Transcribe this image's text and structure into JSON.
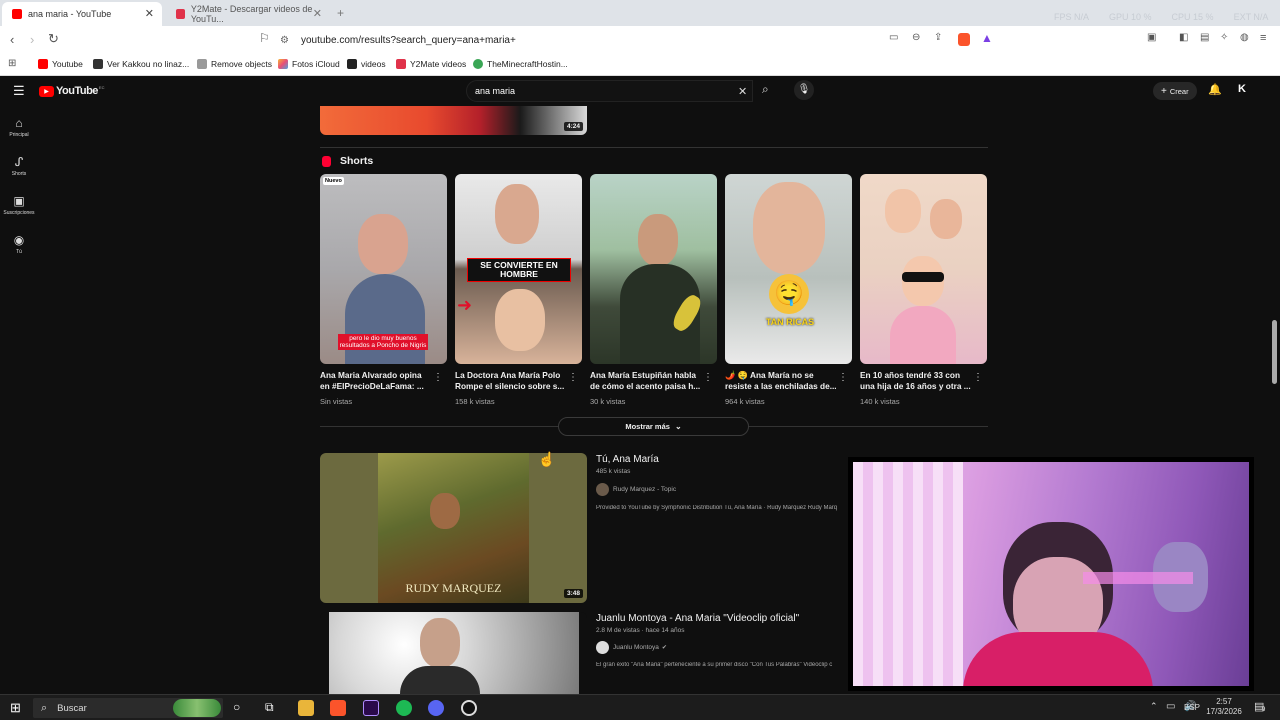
{
  "browser": {
    "tabs": [
      {
        "label": "ana maria - YouTube",
        "active": true
      },
      {
        "label": "Y2Mate - Descargar videos de YouTu...",
        "active": false
      }
    ],
    "new_tab": "+",
    "stats": {
      "fps": "FPS N/A",
      "gpu": "GPU 10 %",
      "cpu": "CPU 15 %",
      "ext": "EXT N/A"
    },
    "url": "youtube.com/results?search_query=ana+maria+",
    "bookmarks": [
      "Youtube",
      "Ver Kakkou no linaz...",
      "Remove objects",
      "Fotos iCloud",
      "videos",
      "Y2Mate videos",
      "TheMinecraftHostin..."
    ]
  },
  "youtube": {
    "logo": "YouTube",
    "region": "EC",
    "search_value": "ana maria",
    "create_label": "Crear",
    "avatar_letter": "K",
    "sidebar": [
      {
        "label": "Principal",
        "icon": "home-icon"
      },
      {
        "label": "Shorts",
        "icon": "shorts-icon"
      },
      {
        "label": "Suscripciones",
        "icon": "subscriptions-icon"
      },
      {
        "label": "Tú",
        "icon": "you-icon"
      }
    ],
    "top_video_duration": "4:24",
    "shorts_title": "Shorts",
    "shorts": [
      {
        "title": "Ana Maria Alvarado opina en #ElPrecioDeLaFama: ...",
        "views": "Sin vistas",
        "badge": "Nuevo",
        "caption": "pero le dio muy buenos resultados a Poncho de Nigris"
      },
      {
        "title": "La Doctora Ana María Polo Rompe el silencio sobre s...",
        "views": "158 k vistas",
        "caption": "SE CONVIERTE EN HOMBRE"
      },
      {
        "title": "Ana María Estupiñán habla de cómo el acento paisa h...",
        "views": "30 k vistas"
      },
      {
        "title": "🌶️ 🤤 Ana María no se resiste a las enchiladas de...",
        "views": "964 k vistas",
        "caption": "TAN RICAS"
      },
      {
        "title": "En 10 años tendré 33 con una hija de 16 años y otra ...",
        "views": "140 k vistas"
      }
    ],
    "show_more": "Mostrar más",
    "videos": [
      {
        "title": "Tú, Ana María",
        "meta": "485 k vistas",
        "channel": "Rudy Marquez - Topic",
        "description": "Provided to YouTube by Symphonic Distribution Tú, Ana María · Rudy Marquez Rudy Marq",
        "duration": "3:48",
        "thumb_text": "RUDY MARQUEZ"
      },
      {
        "title": "Juanlu Montoya - Ana Maria \"Videoclip oficial\"",
        "meta": "2.8 M de vistas · hace 14 años",
        "channel": "Juanlu Montoya",
        "description": "El gran éxito \"Ana Maria\" perteneciente a su primer disco \"Con Tus Palabras\" Videoclip c"
      }
    ]
  },
  "taskbar": {
    "search": "Buscar",
    "lang": "ESP",
    "time": "2:57",
    "date": "17/3/2026",
    "notif_count": "9"
  }
}
